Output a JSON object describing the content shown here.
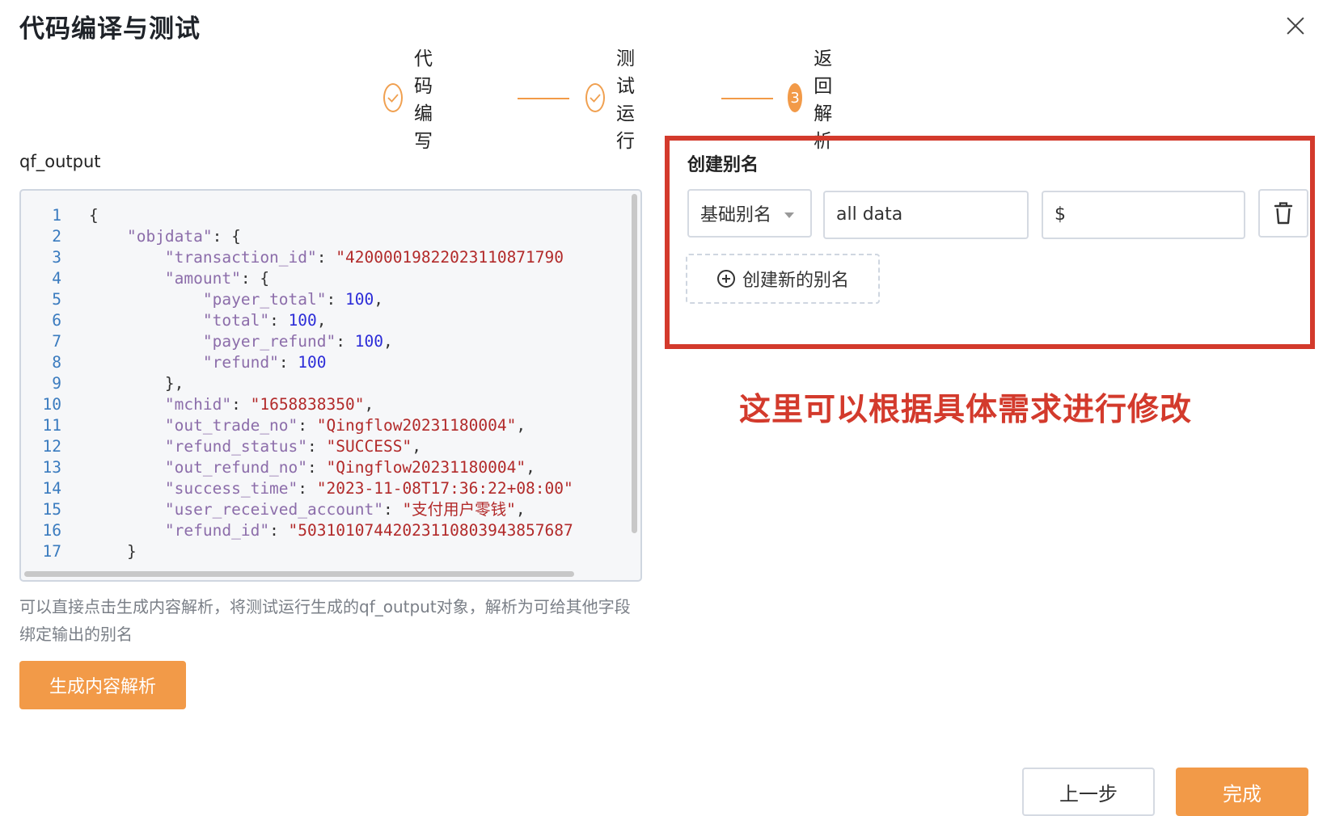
{
  "dialog": {
    "title": "代码编译与测试"
  },
  "steps": [
    {
      "label": "代码编写",
      "status": "done",
      "icon": "check-icon"
    },
    {
      "label": "测试运行",
      "status": "done",
      "icon": "check-icon"
    },
    {
      "label": "返回解析",
      "status": "active",
      "number": "3"
    }
  ],
  "output": {
    "label": "qf_output",
    "code_lines": [
      {
        "n": "1",
        "parts": [
          [
            "pun",
            "{"
          ]
        ],
        "indent": 0
      },
      {
        "n": "2",
        "parts": [
          [
            "key",
            "\"objdata\""
          ],
          [
            "pun",
            ": {"
          ]
        ],
        "indent": 1
      },
      {
        "n": "3",
        "parts": [
          [
            "key",
            "\"transaction_id\""
          ],
          [
            "pun",
            ": "
          ],
          [
            "str",
            "\"42000019822023110871790"
          ]
        ],
        "indent": 2
      },
      {
        "n": "4",
        "parts": [
          [
            "key",
            "\"amount\""
          ],
          [
            "pun",
            ": {"
          ]
        ],
        "indent": 2
      },
      {
        "n": "5",
        "parts": [
          [
            "key",
            "\"payer_total\""
          ],
          [
            "pun",
            ": "
          ],
          [
            "num",
            "100"
          ],
          [
            "pun",
            ","
          ]
        ],
        "indent": 3
      },
      {
        "n": "6",
        "parts": [
          [
            "key",
            "\"total\""
          ],
          [
            "pun",
            ": "
          ],
          [
            "num",
            "100"
          ],
          [
            "pun",
            ","
          ]
        ],
        "indent": 3
      },
      {
        "n": "7",
        "parts": [
          [
            "key",
            "\"payer_refund\""
          ],
          [
            "pun",
            ": "
          ],
          [
            "num",
            "100"
          ],
          [
            "pun",
            ","
          ]
        ],
        "indent": 3
      },
      {
        "n": "8",
        "parts": [
          [
            "key",
            "\"refund\""
          ],
          [
            "pun",
            ": "
          ],
          [
            "num",
            "100"
          ]
        ],
        "indent": 3
      },
      {
        "n": "9",
        "parts": [
          [
            "pun",
            "},"
          ]
        ],
        "indent": 2
      },
      {
        "n": "10",
        "parts": [
          [
            "key",
            "\"mchid\""
          ],
          [
            "pun",
            ": "
          ],
          [
            "str",
            "\"1658838350\""
          ],
          [
            "pun",
            ","
          ]
        ],
        "indent": 2
      },
      {
        "n": "11",
        "parts": [
          [
            "key",
            "\"out_trade_no\""
          ],
          [
            "pun",
            ": "
          ],
          [
            "str",
            "\"Qingflow20231180004\""
          ],
          [
            "pun",
            ","
          ]
        ],
        "indent": 2
      },
      {
        "n": "12",
        "parts": [
          [
            "key",
            "\"refund_status\""
          ],
          [
            "pun",
            ": "
          ],
          [
            "str",
            "\"SUCCESS\""
          ],
          [
            "pun",
            ","
          ]
        ],
        "indent": 2
      },
      {
        "n": "13",
        "parts": [
          [
            "key",
            "\"out_refund_no\""
          ],
          [
            "pun",
            ": "
          ],
          [
            "str",
            "\"Qingflow20231180004\""
          ],
          [
            "pun",
            ","
          ]
        ],
        "indent": 2
      },
      {
        "n": "14",
        "parts": [
          [
            "key",
            "\"success_time\""
          ],
          [
            "pun",
            ": "
          ],
          [
            "str",
            "\"2023-11-08T17:36:22+08:00\""
          ]
        ],
        "indent": 2
      },
      {
        "n": "15",
        "parts": [
          [
            "key",
            "\"user_received_account\""
          ],
          [
            "pun",
            ": "
          ],
          [
            "str",
            "\"支付用户零钱\""
          ],
          [
            "pun",
            ","
          ]
        ],
        "indent": 2
      },
      {
        "n": "16",
        "parts": [
          [
            "key",
            "\"refund_id\""
          ],
          [
            "pun",
            ": "
          ],
          [
            "str",
            "\"50310107442023110803943857687"
          ]
        ],
        "indent": 2
      },
      {
        "n": "17",
        "parts": [
          [
            "pun",
            "}"
          ]
        ],
        "indent": 1
      }
    ],
    "hint": "可以直接点击生成内容解析，将测试运行生成的qf_output对象，解析为可给其他字段绑定输出的别名",
    "generate_button": "生成内容解析"
  },
  "alias": {
    "title": "创建别名",
    "type_select": "基础别名",
    "name_value": "all data",
    "path_value": "$",
    "add_button": "创建新的别名",
    "annotation": "这里可以根据具体需求进行修改"
  },
  "footer": {
    "prev_button": "上一步",
    "done_button": "完成"
  },
  "colors": {
    "accent": "#f29a48",
    "highlight_border": "#d33a2c"
  }
}
